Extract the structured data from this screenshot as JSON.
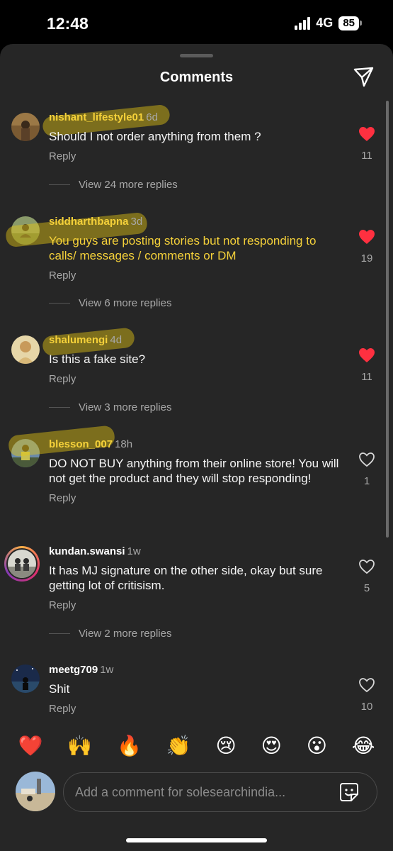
{
  "status_bar": {
    "time": "12:48",
    "network": "4G",
    "battery": "85"
  },
  "sheet": {
    "title": "Comments"
  },
  "comments": [
    {
      "username": "nishant_lifestyle01",
      "age": "6d",
      "text": "Should I not order anything from them ?",
      "reply": "Reply",
      "likes": "11",
      "liked": true,
      "view_replies": "View 24 more replies"
    },
    {
      "username": "siddharthbapna",
      "age": "3d",
      "text": "You guys are posting stories but not responding to calls/ messages / comments or DM",
      "reply": "Reply",
      "likes": "19",
      "liked": true,
      "view_replies": "View 6 more replies"
    },
    {
      "username": "shalumengi",
      "age": "4d",
      "text": "Is this a fake site?",
      "reply": "Reply",
      "likes": "11",
      "liked": true,
      "view_replies": "View 3 more replies"
    },
    {
      "username": "blesson_007",
      "age": "18h",
      "text": "DO NOT BUY anything from their online store! You will not get the product and they will stop responding!",
      "reply": "Reply",
      "likes": "1",
      "liked": false
    },
    {
      "username": "kundan.swansi",
      "age": "1w",
      "text": "It has MJ signature on the other side, okay but sure getting lot of critisism.",
      "reply": "Reply",
      "likes": "5",
      "liked": false,
      "view_replies": "View 2 more replies"
    },
    {
      "username": "meetg709",
      "age": "1w",
      "text": "Shit",
      "reply": "Reply",
      "likes": "10",
      "liked": false
    }
  ],
  "reactions": [
    "❤️",
    "🙌",
    "🔥",
    "👏",
    "😢",
    "😍",
    "😮",
    "😂"
  ],
  "composer": {
    "placeholder": "Add a comment for solesearchindia..."
  },
  "colors": {
    "sheet_bg": "#262626",
    "like_red": "#ff3040",
    "highlight": "#f5d13a",
    "muted": "#a8a8a8"
  },
  "icons": {
    "share": "paper-plane-icon",
    "heart_filled": "heart-filled-icon",
    "heart_outline": "heart-outline-icon",
    "sticker": "sticker-icon"
  }
}
